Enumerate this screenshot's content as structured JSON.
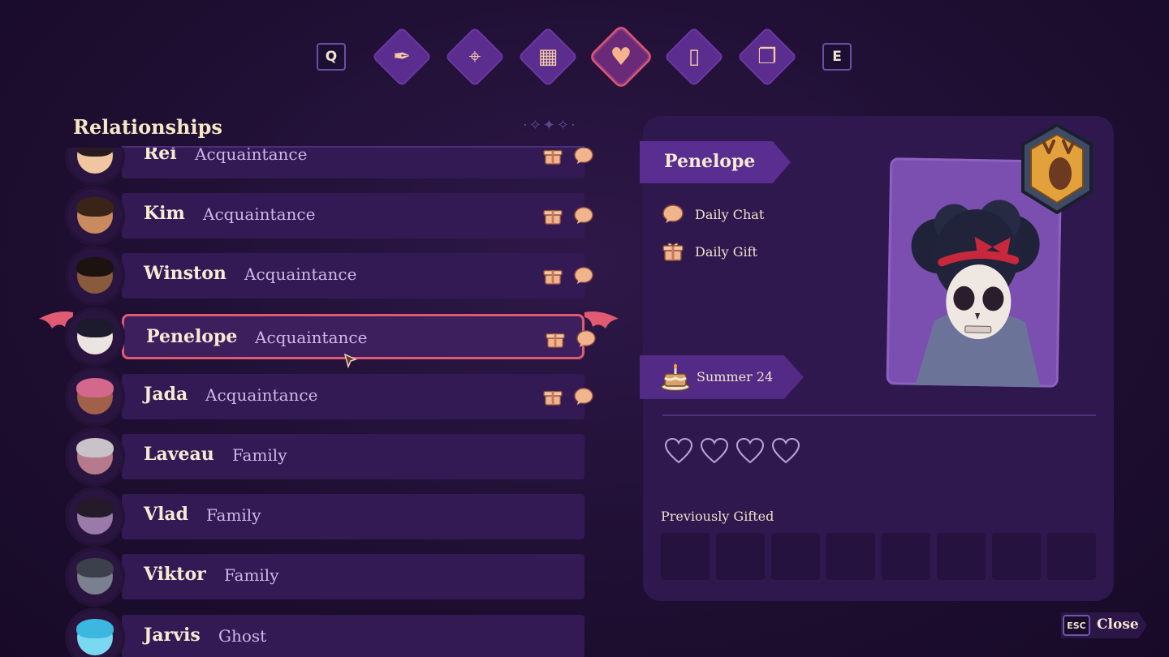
{
  "nav": {
    "prev_key": "Q",
    "next_key": "E",
    "tabs": [
      {
        "name": "tab-quests",
        "icon": "quill-icon",
        "glyph": "✒",
        "active": false
      },
      {
        "name": "tab-map",
        "icon": "map-icon",
        "glyph": "⌖",
        "active": false
      },
      {
        "name": "tab-calendar",
        "icon": "calendar-icon",
        "glyph": "▦",
        "active": false
      },
      {
        "name": "tab-relationships",
        "icon": "heart-icon",
        "glyph": "♥",
        "active": true
      },
      {
        "name": "tab-collections",
        "icon": "tome-icon",
        "glyph": "▯",
        "active": false
      },
      {
        "name": "tab-journal",
        "icon": "open-book-icon",
        "glyph": "❐",
        "active": false
      }
    ]
  },
  "list": {
    "title": "Relationships",
    "rows": [
      {
        "name": "Rei",
        "status": "Acquaintance",
        "gift": true,
        "chat": true,
        "skin": "#f0c6a0",
        "hair": "#2a1a22"
      },
      {
        "name": "Kim",
        "status": "Acquaintance",
        "gift": true,
        "chat": true,
        "skin": "#c98a60",
        "hair": "#3a2418"
      },
      {
        "name": "Winston",
        "status": "Acquaintance",
        "gift": true,
        "chat": true,
        "skin": "#8a5a3c",
        "hair": "#1c1210"
      },
      {
        "name": "Penelope",
        "status": "Acquaintance",
        "gift": true,
        "chat": true,
        "skin": "#ece4e0",
        "hair": "#1c1a2c",
        "selected": true
      },
      {
        "name": "Jada",
        "status": "Acquaintance",
        "gift": true,
        "chat": true,
        "skin": "#a0604a",
        "hair": "#d4688c"
      },
      {
        "name": "Laveau",
        "status": "Family",
        "gift": false,
        "chat": false,
        "skin": "#b57a8c",
        "hair": "#c9c2c8"
      },
      {
        "name": "Vlad",
        "status": "Family",
        "gift": false,
        "chat": false,
        "skin": "#9a7aa8",
        "hair": "#241a2a"
      },
      {
        "name": "Viktor",
        "status": "Family",
        "gift": false,
        "chat": false,
        "skin": "#7a8090",
        "hair": "#3c3f4c"
      },
      {
        "name": "Jarvis",
        "status": "Ghost",
        "gift": false,
        "chat": false,
        "skin": "#7ad8f0",
        "hair": "#3cb8e0"
      }
    ]
  },
  "detail": {
    "name": "Penelope",
    "daily_chat": "Daily Chat",
    "daily_gift": "Daily Gift",
    "birthday": "Summer 24",
    "hearts_filled": 0,
    "hearts_total": 4,
    "previously_gifted_label": "Previously Gifted",
    "gift_slot_count": 8,
    "badge_icon": "deer-crest-icon"
  },
  "footer": {
    "esc_key": "ESC",
    "close_label": "Close"
  }
}
